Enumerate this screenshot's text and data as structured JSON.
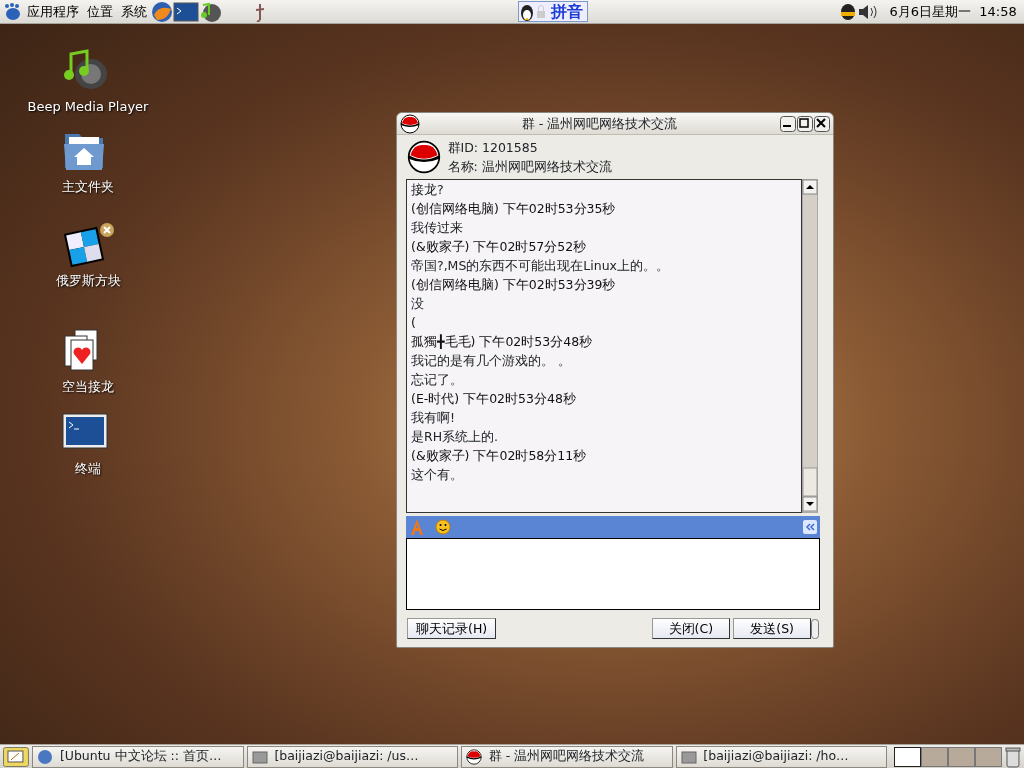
{
  "top_panel": {
    "menus": [
      "应用程序",
      "位置",
      "系统"
    ],
    "ime": {
      "label": "拼音"
    },
    "clock": "6月6日星期一  14:58"
  },
  "desktop_icons": [
    {
      "kind": "music",
      "label": "Beep Media Player"
    },
    {
      "kind": "folder",
      "label": "主文件夹"
    },
    {
      "kind": "tetris",
      "label": "俄罗斯方块"
    },
    {
      "kind": "cards",
      "label": "空当接龙"
    },
    {
      "kind": "terminal",
      "label": "终端"
    }
  ],
  "chat_window": {
    "title": "群 - 温州网吧网络技术交流",
    "group_id": "群ID: 1201585",
    "group_name": "名称: 温州网吧网络技术交流",
    "messages": [
      {
        "kind": "text",
        "text": "接龙?"
      },
      {
        "kind": "header",
        "text": "(创信网络电脑)  下午02时53分35秒"
      },
      {
        "kind": "text",
        "text": "我传过来"
      },
      {
        "kind": "header",
        "text": "(&败家子)  下午02时57分52秒"
      },
      {
        "kind": "text",
        "text": "帝国?,MS的东西不可能出现在Linux上的。。"
      },
      {
        "kind": "header",
        "text": "(创信网络电脑)  下午02时53分39秒"
      },
      {
        "kind": "text",
        "text": "没"
      },
      {
        "kind": "header",
        "text": "("
      },
      {
        "kind": "header",
        "text": "孤獨╋毛毛)  下午02时53分48秒"
      },
      {
        "kind": "text",
        "text": "我记的是有几个游戏的。 。"
      },
      {
        "kind": "text",
        "text": "忘记了。"
      },
      {
        "kind": "header",
        "text": "(E-时代)  下午02时53分48秒"
      },
      {
        "kind": "text",
        "text": "我有啊!"
      },
      {
        "kind": "text",
        "text": "是RH系统上的."
      },
      {
        "kind": "header",
        "text": "(&败家子)  下午02时58分11秒"
      },
      {
        "kind": "text",
        "text": "这个有。"
      }
    ],
    "buttons": {
      "history": "聊天记录(H)",
      "close": "关闭(C)",
      "send": "发送(S)"
    }
  },
  "taskbar": {
    "tasks": [
      {
        "kind": "browser",
        "label": "[Ubuntu 中文论坛 :: 首页…"
      },
      {
        "kind": "terminal",
        "label": "[baijiazi@baijiazi: /us…"
      },
      {
        "kind": "chat",
        "label": "群 - 温州网吧网络技术交流"
      },
      {
        "kind": "terminal",
        "label": "[baijiazi@baijiazi: /ho…"
      }
    ],
    "workspaces": [
      {
        "selected": true
      },
      {
        "selected": false
      },
      {
        "selected": false
      },
      {
        "selected": false
      }
    ]
  }
}
